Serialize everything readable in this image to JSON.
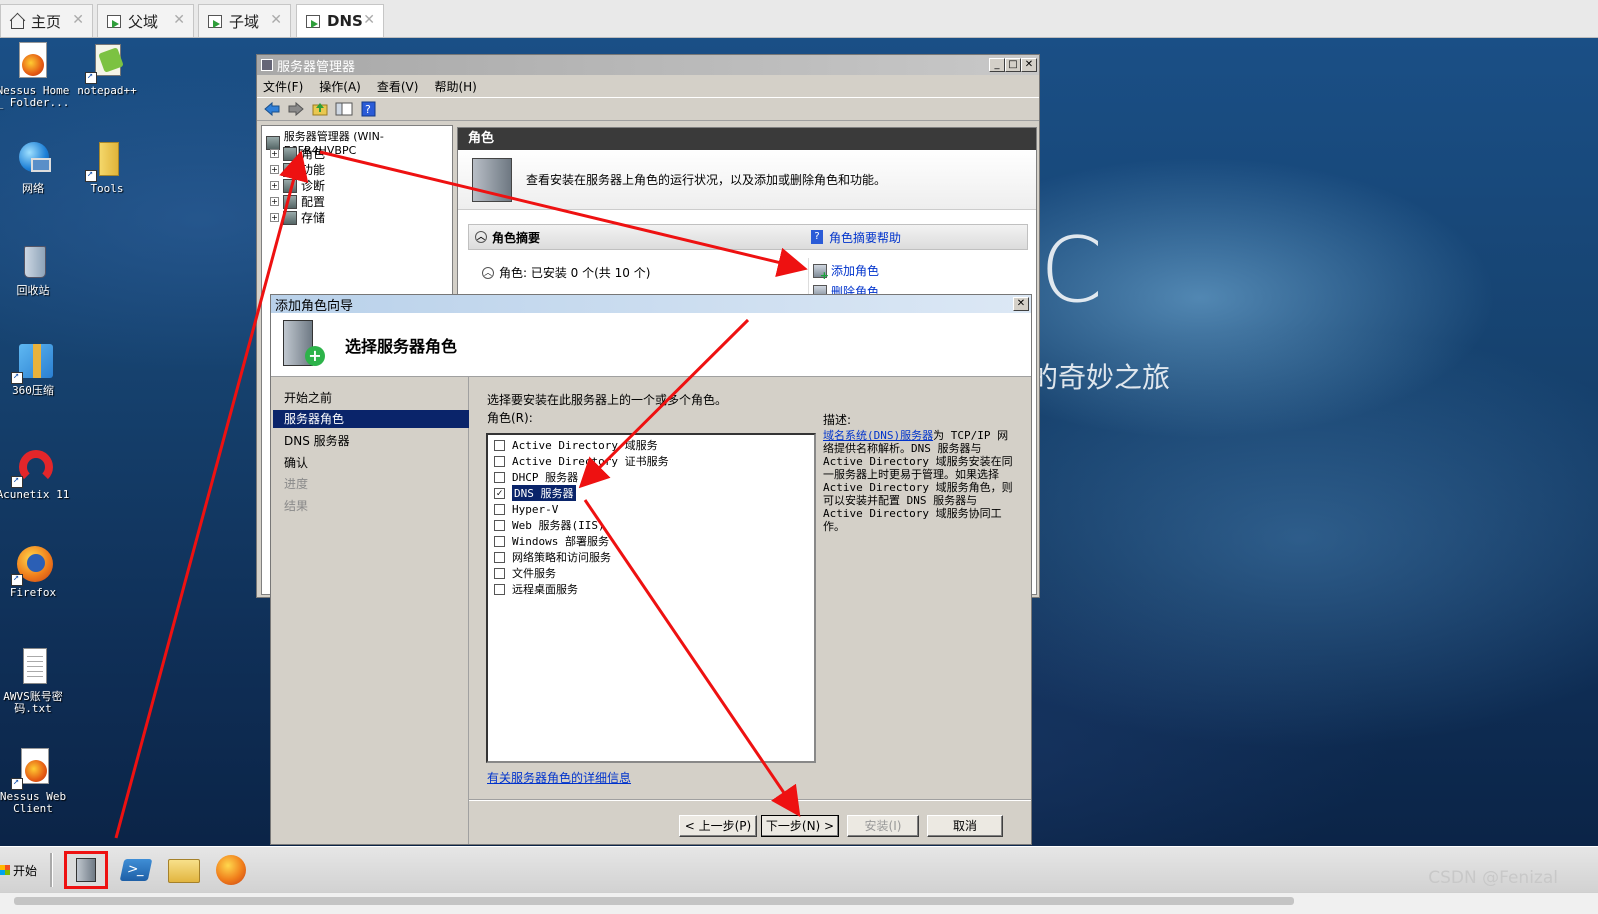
{
  "vm_tabs": [
    {
      "label": "主页",
      "icon": "home-icon"
    },
    {
      "label": "父域",
      "icon": "vm-icon"
    },
    {
      "label": "子域",
      "icon": "vm-icon"
    },
    {
      "label": "DNS",
      "icon": "vm-icon",
      "active": true
    }
  ],
  "wallpaper": {
    "big_letter": "C",
    "slogan": "的奇妙之旅"
  },
  "desktop_icons": [
    {
      "label": "Nessus Home _ Folder...",
      "icon": "firefox-icon"
    },
    {
      "label": "notepad++",
      "icon": "notepad-icon"
    },
    {
      "label": "网络",
      "icon": "network-icon"
    },
    {
      "label": "Tools",
      "icon": "folder-icon"
    },
    {
      "label": "回收站",
      "icon": "recycle-bin-icon"
    },
    {
      "label": "360压缩",
      "icon": "archive-icon"
    },
    {
      "label": "Acunetix 11",
      "icon": "acunetix-icon"
    },
    {
      "label": "Firefox",
      "icon": "firefox-icon"
    },
    {
      "label": "AWVS账号密码.txt",
      "icon": "text-file-icon"
    },
    {
      "label": "Nessus Web Client",
      "icon": "firefox-icon"
    }
  ],
  "server_manager": {
    "title": "服务器管理器",
    "menu": [
      "文件(F)",
      "操作(A)",
      "查看(V)",
      "帮助(H)"
    ],
    "tree_root": "服务器管理器 (WIN-E6FR4HVBPC",
    "tree_items": [
      "角色",
      "功能",
      "诊断",
      "配置",
      "存储"
    ],
    "pane_title": "角色",
    "pane_desc": "查看安装在服务器上角色的运行状况，以及添加或删除角色和功能。",
    "summary_title": "角色摘要",
    "summary_help": "角色摘要帮助",
    "roles_status": "角色: 已安装 0 个(共 10 个)",
    "add_roles": "添加角色",
    "remove_roles": "删除角色"
  },
  "wizard": {
    "title": "添加角色向导",
    "heading": "选择服务器角色",
    "steps": [
      {
        "label": "开始之前",
        "state": "done"
      },
      {
        "label": "服务器角色",
        "state": "current"
      },
      {
        "label": "DNS 服务器",
        "state": "next"
      },
      {
        "label": "确认",
        "state": "next"
      },
      {
        "label": "进度",
        "state": "disabled"
      },
      {
        "label": "结果",
        "state": "disabled"
      }
    ],
    "instruction": "选择要安装在此服务器上的一个或多个角色。",
    "roles_label": "角色(R):",
    "roles": [
      {
        "label": "Active Directory 域服务",
        "checked": false
      },
      {
        "label": "Active Directory 证书服务",
        "checked": false
      },
      {
        "label": "DHCP 服务器",
        "checked": false
      },
      {
        "label": "DNS 服务器",
        "checked": true,
        "selected": true
      },
      {
        "label": "Hyper-V",
        "checked": false
      },
      {
        "label": "Web 服务器(IIS)",
        "checked": false
      },
      {
        "label": "Windows 部署服务",
        "checked": false
      },
      {
        "label": "网络策略和访问服务",
        "checked": false
      },
      {
        "label": "文件服务",
        "checked": false
      },
      {
        "label": "远程桌面服务",
        "checked": false
      }
    ],
    "desc_label": "描述:",
    "desc_link": "域名系统(DNS)服务器",
    "desc_text": "为 TCP/IP 网络提供名称解析。DNS 服务器与 Active Directory 域服务安装在同一服务器上时更易于管理。如果选择 Active Directory 域服务角色，则可以安装并配置 DNS 服务器与 Active Directory 域服务协同工作。",
    "more_info": "有关服务器角色的详细信息",
    "buttons": {
      "back": "< 上一步(P)",
      "next": "下一步(N) >",
      "install": "安装(I)",
      "cancel": "取消"
    }
  },
  "taskbar": {
    "start": "开始",
    "items": [
      "server-manager-icon",
      "powershell-icon",
      "explorer-icon",
      "firefox-icon"
    ]
  },
  "watermark": "CSDN @Fenizal",
  "annotation_color": "#ee1111"
}
